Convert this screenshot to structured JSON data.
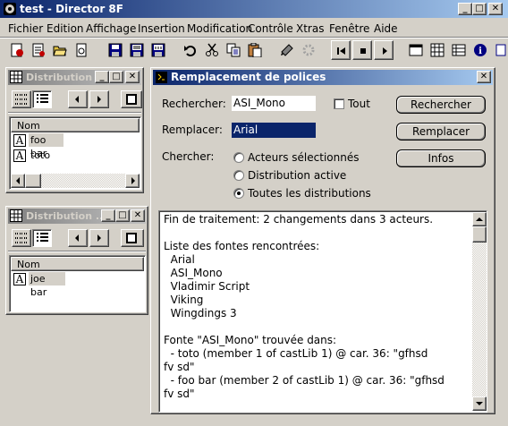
{
  "app": {
    "title": "test - Director 8F",
    "icon_name": "director-icon"
  },
  "menu": [
    {
      "label": "Fichier",
      "u": "F"
    },
    {
      "label": "Edition",
      "u": "E"
    },
    {
      "label": "Affichage",
      "u": ""
    },
    {
      "label": "Insertion",
      "u": "I"
    },
    {
      "label": "Modification",
      "u": "M"
    },
    {
      "label": "Contrôle",
      "u": "C"
    },
    {
      "label": "Xtras",
      "u": "X"
    },
    {
      "label": "Fenêtre",
      "u": "n"
    },
    {
      "label": "Aide",
      "u": "A"
    }
  ],
  "cast1": {
    "title": "Distribution ...",
    "column_header": "Nom",
    "items": [
      {
        "name": "foo bar",
        "selected": true
      },
      {
        "name": "toto",
        "selected": false
      }
    ]
  },
  "cast2": {
    "title": "Distribution ...",
    "column_header": "Nom",
    "items": [
      {
        "name": "joe bar",
        "selected": true
      }
    ]
  },
  "dialog": {
    "title": "Remplacement de polices",
    "search_label": "Rechercher:",
    "search_value": "ASI_Mono",
    "all_label": "Tout",
    "all_checked": false,
    "replace_label": "Remplacer:",
    "replace_value": "Arial",
    "scope_label": "Chercher:",
    "options": [
      {
        "label": "Acteurs sélectionnés",
        "selected": false
      },
      {
        "label": "Distribution active",
        "selected": false
      },
      {
        "label": "Toutes les distributions",
        "selected": true
      }
    ],
    "buttons": {
      "search": "Rechercher",
      "replace": "Remplacer",
      "info": "Infos"
    },
    "results": [
      "Fin de traitement: 2 changements dans 3 acteurs.",
      "",
      "Liste des fontes rencontrées:",
      "  Arial",
      "  ASI_Mono",
      "  Vladimir Script",
      "  Viking",
      "  Wingdings 3",
      "",
      "Fonte \"ASI_Mono\" trouvée dans:",
      "  - toto (member 1 of castLib 1) @ car. 36: \"gfhsd",
      "fv sd\"",
      "  - foo bar (member 2 of castLib 1) @ car. 36: \"gfhsd",
      "fv sd\""
    ]
  }
}
